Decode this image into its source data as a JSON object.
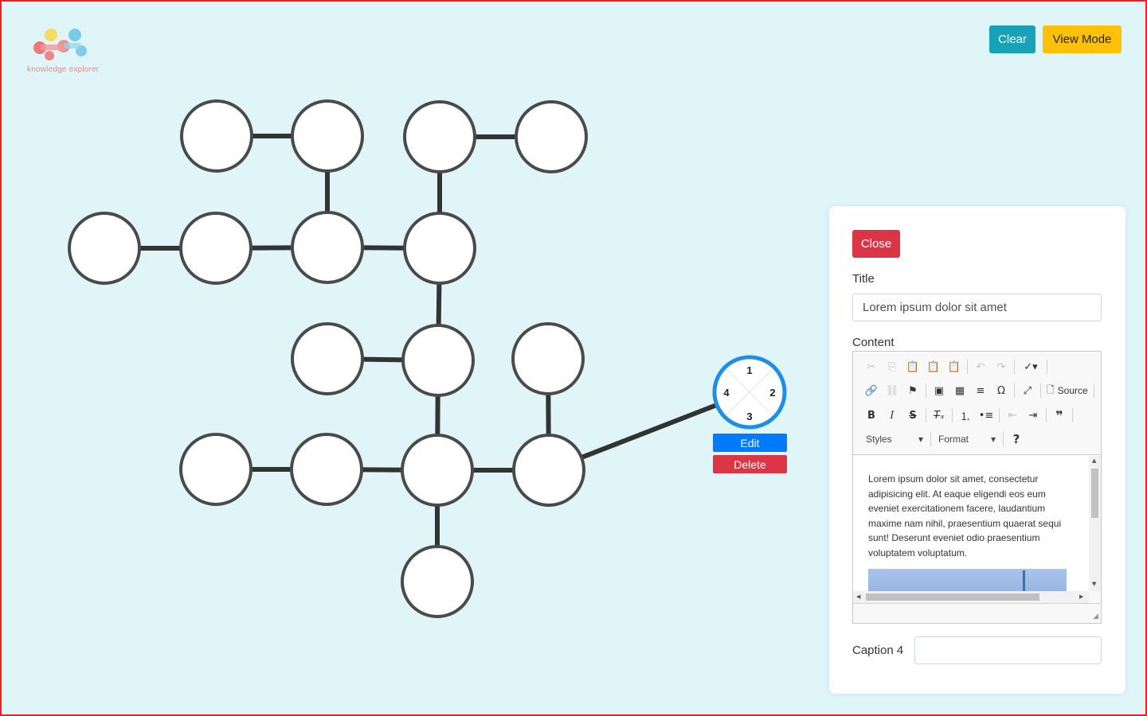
{
  "app": {
    "logo_caption": "knowledge explorer"
  },
  "header": {
    "clear_label": "Clear",
    "view_mode_label": "View Mode"
  },
  "node_menu": {
    "quadrant_1": "1",
    "quadrant_2": "2",
    "quadrant_3": "3",
    "quadrant_4": "4",
    "edit_label": "Edit",
    "delete_label": "Delete"
  },
  "panel": {
    "close_label": "Close",
    "title_label": "Title",
    "title_value": "Lorem ipsum dolor sit amet",
    "content_label": "Content",
    "editor": {
      "source_label": "Source",
      "styles_label": "Styles",
      "format_label": "Format",
      "body_text": "Lorem ipsum dolor sit amet, consectetur adipisicing elit. At eaque eligendi eos eum eveniet exercitationem facere, laudantium maxime nam nihil, praesentium quaerat sequi sunt! Deserunt eveniet odio praesentium voluptatem voluptatum."
    },
    "caption_label": "Caption 4",
    "caption_value": ""
  },
  "colors": {
    "background": "#dff5f8",
    "node_stroke": "#4a4a4a",
    "selected_node_stroke": "#1e8fe6",
    "clear_button": "#17a2b8",
    "view_mode_button": "#ffc107",
    "edit_button": "#007bff",
    "delete_button": "#dc3545"
  }
}
